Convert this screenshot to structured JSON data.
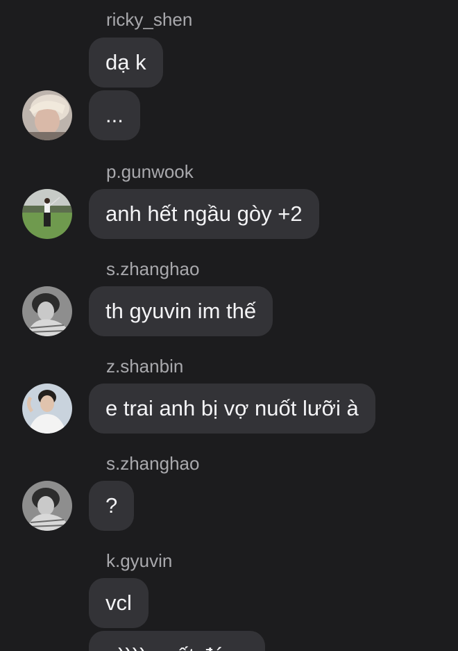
{
  "messages": [
    {
      "sender": "ricky_shen",
      "lines": [
        "dạ k",
        "..."
      ]
    },
    {
      "sender": "p.gunwook",
      "lines": [
        "anh hết ngầu gòy +2"
      ]
    },
    {
      "sender": "s.zhanghao",
      "lines": [
        "th gyuvin im thế"
      ]
    },
    {
      "sender": "z.shanbin",
      "lines": [
        "e trai anh bị vợ nuốt lưỡi à"
      ]
    },
    {
      "sender": "s.zhanghao",
      "lines": [
        "?"
      ]
    },
    {
      "sender": "k.gyuvin",
      "lines": [
        "vcl",
        "=)))) nuốt đúng"
      ]
    }
  ],
  "colors": {
    "background": "#1c1c1e",
    "bubble": "#333337",
    "sender_text": "#a9a9ad",
    "message_text": "#f4f4f6"
  }
}
